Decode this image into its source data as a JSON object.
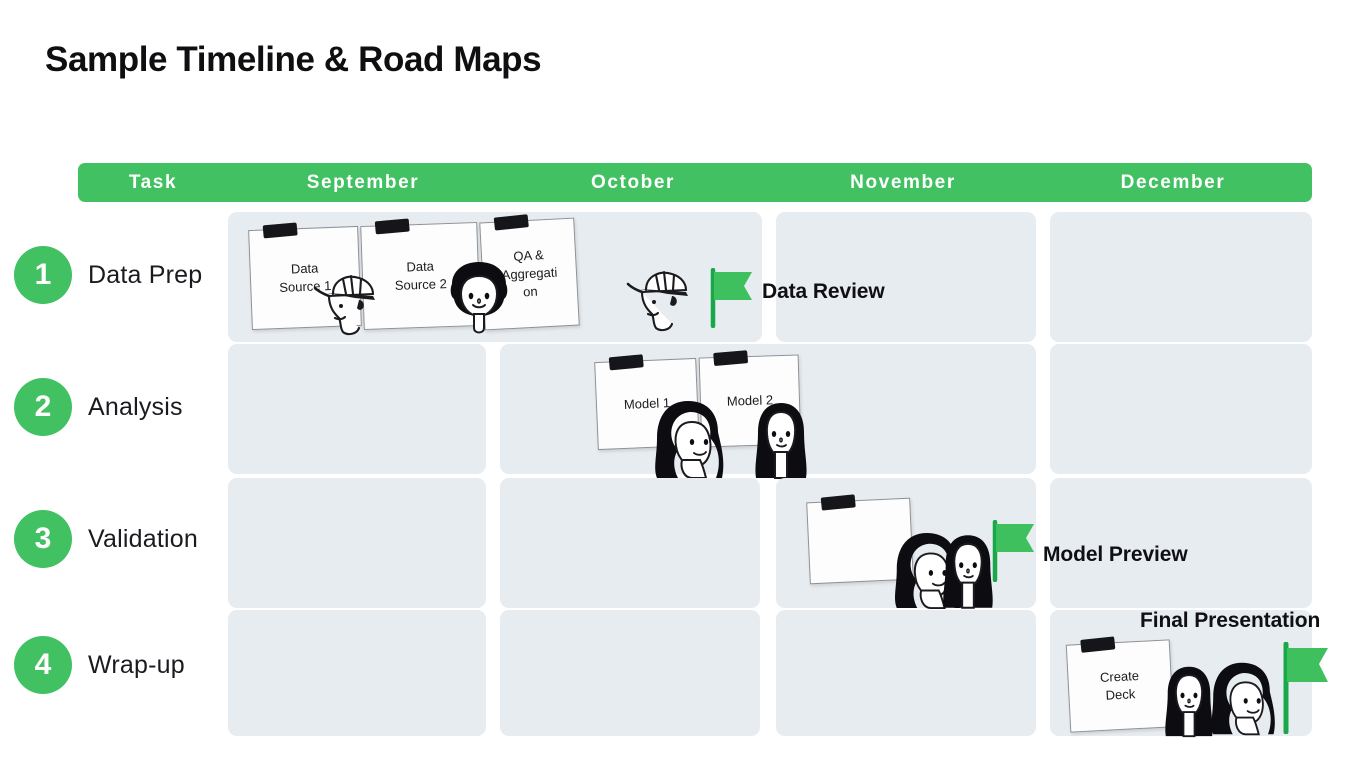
{
  "title": "Sample Timeline & Road Maps",
  "header": {
    "columns": [
      {
        "label": "Task"
      },
      {
        "label": "September"
      },
      {
        "label": "October"
      },
      {
        "label": "November"
      },
      {
        "label": "December"
      }
    ]
  },
  "colors": {
    "accent_green": "#42c163",
    "cell_background": "#e7ecf0",
    "text_dark": "#101014",
    "header_text": "#ffffff",
    "note_paper": "#fdfdfd",
    "tape_black": "#15151a"
  },
  "rows": [
    {
      "number": "1",
      "label": "Data Prep",
      "notes": [
        {
          "text": "Data\nSource 1"
        },
        {
          "text": "Data\nSource 2"
        },
        {
          "text": "QA &\nAggregati\non"
        }
      ],
      "milestone": {
        "label": "Data Review",
        "icon": "flag-icon"
      }
    },
    {
      "number": "2",
      "label": "Analysis",
      "notes": [
        {
          "text": "Model 1"
        },
        {
          "text": "Model 2"
        }
      ],
      "milestone": null
    },
    {
      "number": "3",
      "label": "Validation",
      "notes": [
        {
          "text": ""
        }
      ],
      "milestone": {
        "label": "Model Preview",
        "icon": "flag-icon"
      }
    },
    {
      "number": "4",
      "label": "Wrap-up",
      "notes": [
        {
          "text": "Create\nDeck"
        }
      ],
      "milestone": {
        "label": "Final Presentation",
        "icon": "flag-icon"
      }
    }
  ]
}
